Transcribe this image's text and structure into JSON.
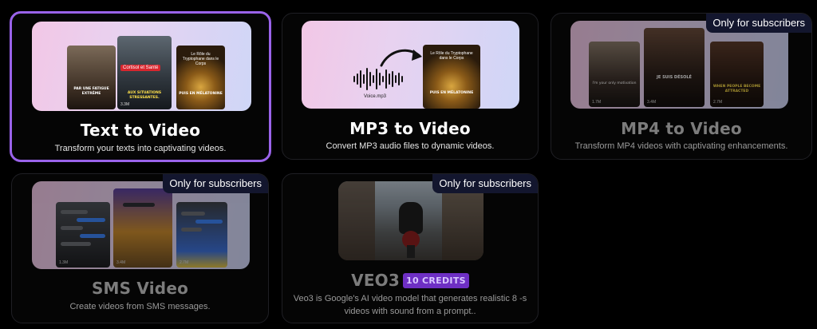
{
  "badge_text": "Only for subscribers",
  "cards": [
    {
      "title": "Text to Video",
      "description": "Transform your texts into captivating videos.",
      "phone1_caption": "Par une fatigue extrême",
      "phone2_tag": "Cortisol et Santé",
      "phone2_caption": "Aux situations stressantes.",
      "phone2_views": "3.3M",
      "phone3_title": "Le Rôle du Tryptophane dans le Corps",
      "phone3_caption": "Puis en mélatonine"
    },
    {
      "title": "MP3 to Video",
      "description": "Convert MP3 audio files to dynamic videos.",
      "audio_label": "Voice.mp3",
      "phone_title": "Le Rôle du Tryptophane dans le Corps",
      "phone_caption": "Puis en mélatonine"
    },
    {
      "title": "MP4 to Video",
      "description": "Transform MP4 videos with captivating enhancements.",
      "phone1_caption": "I'm your only motivation",
      "phone2_caption": "Je suis désolé",
      "phone3_caption": "When people become attracted",
      "phone1_views": "1.7M",
      "phone2_views": "3.4M",
      "phone3_views": "2.7M"
    },
    {
      "title": "SMS Video",
      "description": "Create videos from SMS messages.",
      "phone1_views": "1.3M",
      "phone2_views": "3.4M",
      "phone3_views": "2.7M"
    },
    {
      "title": "VEO3",
      "credits": "10 CREDITS",
      "description_line1": "Veo3 is Google's AI video model that generates realistic 8 -s",
      "description_line2": "videos with sound from a prompt.."
    }
  ],
  "colors": {
    "selected_border": "#9a63ea",
    "badge_bg": "#13162e",
    "credits_bg": "#6e2fc4"
  },
  "icons": [
    "arrow-icon",
    "waveform-icon"
  ]
}
